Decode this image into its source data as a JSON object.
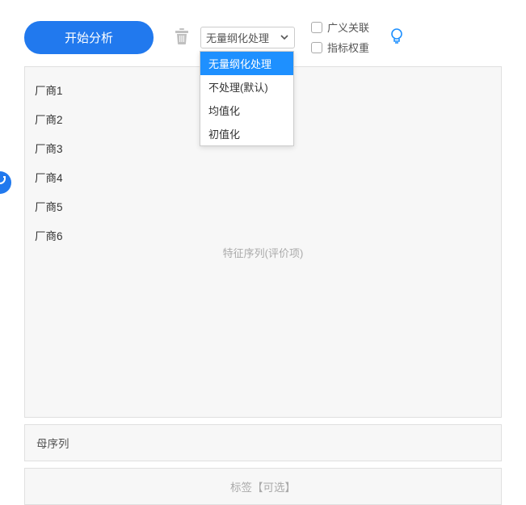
{
  "top": {
    "start_button": "开始分析",
    "select_value": "无量纲化处理",
    "dropdown": [
      {
        "label": "无量纲化处理",
        "selected": true
      },
      {
        "label": "不处理(默认)",
        "selected": false
      },
      {
        "label": "均值化",
        "selected": false
      },
      {
        "label": "初值化",
        "selected": false
      }
    ],
    "check1": "广义关联",
    "check2": "指标权重"
  },
  "items": [
    "厂商1",
    "厂商2",
    "厂商3",
    "厂商4",
    "厂商5",
    "厂商6"
  ],
  "placeholder_main": "特征序列(评价项)",
  "row_mother": "母序列",
  "row_label": "标签【可选】"
}
